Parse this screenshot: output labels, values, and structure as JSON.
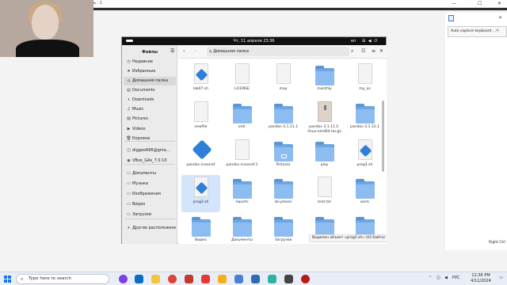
{
  "host": {
    "title": "ь : 1",
    "controls": [
      "—",
      "☐",
      "✕"
    ]
  },
  "gnome": {
    "clock": "Чт, 11 апреля  23:36",
    "lang": "en"
  },
  "sidebar": {
    "title": "Файлы",
    "items": [
      {
        "icon": "clock-icon",
        "glyph": "◷",
        "label": "Недавние"
      },
      {
        "icon": "star-icon",
        "glyph": "★",
        "label": "Избранные"
      },
      {
        "icon": "home-icon",
        "glyph": "⌂",
        "label": "Домашняя папка",
        "selected": true
      },
      {
        "icon": "documents-icon",
        "glyph": "▤",
        "label": "Documents"
      },
      {
        "icon": "downloads-icon",
        "glyph": "⭳",
        "label": "Downloads"
      },
      {
        "icon": "music-icon",
        "glyph": "♫",
        "label": "Music"
      },
      {
        "icon": "pictures-icon",
        "glyph": "▨",
        "label": "Pictures"
      },
      {
        "icon": "videos-icon",
        "glyph": "▶",
        "label": "Videos"
      },
      {
        "icon": "trash-icon",
        "glyph": "🗑",
        "label": "Корзина"
      },
      {
        "icon": "drive-icon",
        "glyph": "◫",
        "label": "diggoo666@gma..."
      },
      {
        "icon": "disc-icon",
        "glyph": "◉",
        "label": "VBox_GAs_7.0.10"
      },
      {
        "icon": "folder-icon",
        "glyph": "▭",
        "label": "Документы"
      },
      {
        "icon": "folder-icon",
        "glyph": "▭",
        "label": "Музыка"
      },
      {
        "icon": "folder-icon",
        "glyph": "▭",
        "label": "Изображения"
      },
      {
        "icon": "folder-icon",
        "glyph": "▭",
        "label": "Видео"
      },
      {
        "icon": "folder-icon",
        "glyph": "▭",
        "label": "Загрузки"
      },
      {
        "icon": "plus-icon",
        "glyph": "+",
        "label": "Другие расположения"
      }
    ]
  },
  "header": {
    "path": "Домашняя папка"
  },
  "files": [
    {
      "label": "lab07.sh",
      "type": "script"
    },
    {
      "label": "LICENSE",
      "type": "text"
    },
    {
      "label": "may",
      "type": "text"
    },
    {
      "label": "monthly",
      "type": "folder"
    },
    {
      "label": "my_os",
      "type": "text"
    },
    {
      "label": "newfile",
      "type": "text"
    },
    {
      "label": "ontr",
      "type": "folder"
    },
    {
      "label": "pandoc-3.1.11.1",
      "type": "folder"
    },
    {
      "label": "pandoc-3.1.11.1-linux-amd64.tar.gz",
      "type": "archive"
    },
    {
      "label": "pandoc-3.1.12.1",
      "type": "folder"
    },
    {
      "label": "pandoc-crossref",
      "type": "bigscript"
    },
    {
      "label": "pandoc-crossref.1",
      "type": "text"
    },
    {
      "label": "Pictures",
      "type": "pictures"
    },
    {
      "label": "play",
      "type": "folder"
    },
    {
      "label": "prog1.sh",
      "type": "script"
    },
    {
      "label": "prog2.sh",
      "type": "script",
      "selected": true
    },
    {
      "label": "reports",
      "type": "folder"
    },
    {
      "label": "ski.plases",
      "type": "folder"
    },
    {
      "label": "text.txt",
      "type": "text"
    },
    {
      "label": "work",
      "type": "folder"
    },
    {
      "label": "Видео",
      "type": "folder"
    },
    {
      "label": "Документы",
      "type": "folder"
    },
    {
      "label": "Загрузки",
      "type": "folder"
    },
    {
      "label": "",
      "type": "folder"
    },
    {
      "label": "",
      "type": "folder"
    }
  ],
  "status": "Выделен объект «prog2.sh» (43 байта)",
  "right_panel": {
    "label": "Auto capture keyboard ..."
  },
  "taskbar": {
    "search_placeholder": "Type here to search",
    "lang": "РУС",
    "time": "11:36 PM",
    "date": "4/11/2024",
    "right_ctrl": "Right Ctrl"
  }
}
